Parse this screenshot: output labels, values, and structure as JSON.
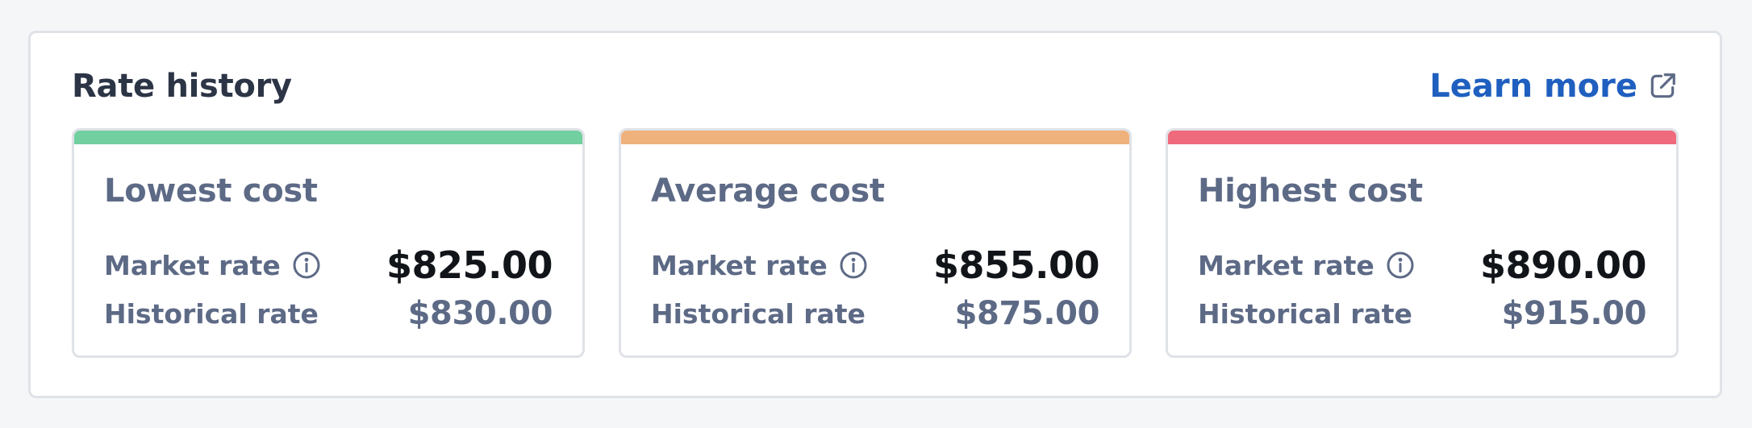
{
  "header": {
    "title": "Rate history",
    "learn_more_label": "Learn more",
    "learn_more_icon": "external-link-icon",
    "link_color": "#1f5fbf"
  },
  "cards": [
    {
      "title": "Lowest cost",
      "accent_color": "#72cfa0",
      "market_label": "Market rate",
      "market_icon": "info-icon",
      "market_value": "$825.00",
      "historical_label": "Historical rate",
      "historical_value": "$830.00"
    },
    {
      "title": "Average cost",
      "accent_color": "#f0b27d",
      "market_label": "Market rate",
      "market_icon": "info-icon",
      "market_value": "$855.00",
      "historical_label": "Historical rate",
      "historical_value": "$875.00"
    },
    {
      "title": "Highest cost",
      "accent_color": "#ef6a7c",
      "market_label": "Market rate",
      "market_icon": "info-icon",
      "market_value": "$890.00",
      "historical_label": "Historical rate",
      "historical_value": "$915.00"
    }
  ]
}
